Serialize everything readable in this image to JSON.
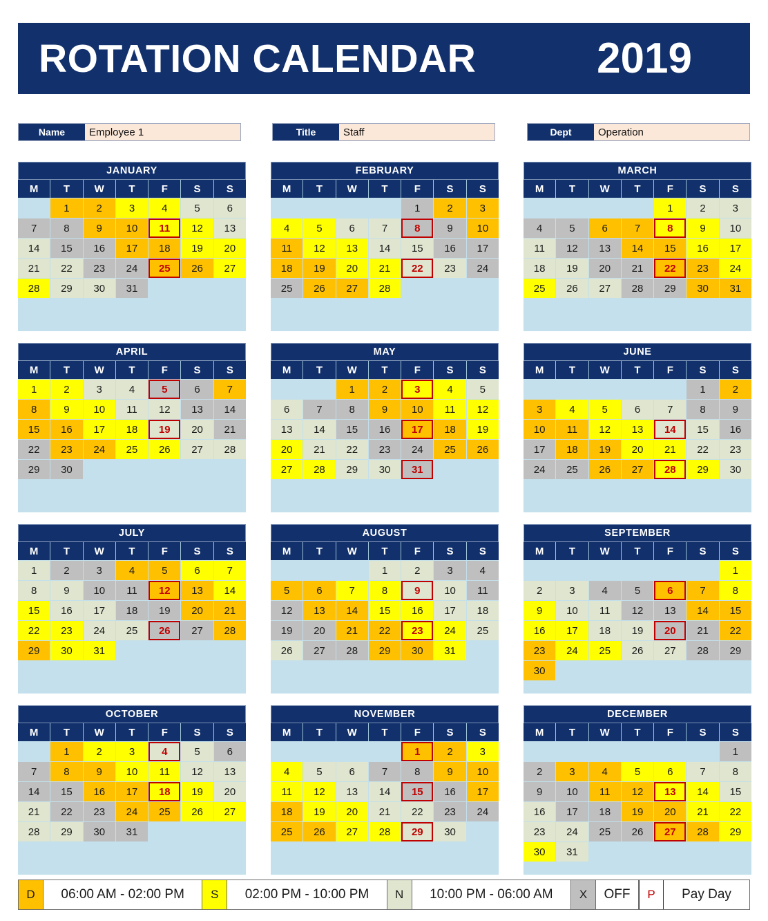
{
  "banner": {
    "title": "ROTATION CALENDAR",
    "year": "2019"
  },
  "info": {
    "name": {
      "label": "Name",
      "value": "Employee 1"
    },
    "title": {
      "label": "Title",
      "value": "Staff"
    },
    "dept": {
      "label": "Dept",
      "value": "Operation"
    }
  },
  "day_headers": [
    "M",
    "T",
    "W",
    "T",
    "F",
    "S",
    "S"
  ],
  "colors": {
    "header_navy": "#12306B",
    "month_bg": "#C3E0EC",
    "shift_D": "#FFC000",
    "shift_S": "#FFFF00",
    "shift_N": "#DFE5CE",
    "shift_X": "#BFBFBF",
    "payday_border": "#C00000",
    "field_value_bg": "#FCE8D9"
  },
  "legend": [
    {
      "code": "D",
      "text": "06:00 AM - 02:00 PM"
    },
    {
      "code": "S",
      "text": "02:00 PM - 10:00 PM"
    },
    {
      "code": "N",
      "text": "10:00 PM - 06:00 AM"
    },
    {
      "code": "X",
      "text": "OFF"
    },
    {
      "code": "P",
      "text": "Pay Day"
    }
  ],
  "months": [
    {
      "name": "JANUARY",
      "lead_blanks": 1,
      "days": 31,
      "shifts": [
        "D",
        "D",
        "S",
        "S",
        "N",
        "N",
        "X",
        "X",
        "D",
        "D",
        "S",
        "S",
        "N",
        "N",
        "X",
        "X",
        "D",
        "D",
        "S",
        "S",
        "N",
        "N",
        "X",
        "X",
        "D",
        "D",
        "S",
        "S",
        "N",
        "N",
        "X"
      ],
      "paydays": [
        11,
        25
      ]
    },
    {
      "name": "FEBRUARY",
      "lead_blanks": 4,
      "days": 28,
      "shifts": [
        "X",
        "D",
        "D",
        "S",
        "S",
        "N",
        "N",
        "X",
        "X",
        "D",
        "D",
        "S",
        "S",
        "N",
        "N",
        "X",
        "X",
        "D",
        "D",
        "S",
        "S",
        "N",
        "N",
        "X",
        "X",
        "D",
        "D",
        "S"
      ],
      "paydays": [
        8,
        22
      ]
    },
    {
      "name": "MARCH",
      "lead_blanks": 4,
      "days": 31,
      "shifts": [
        "S",
        "N",
        "N",
        "X",
        "X",
        "D",
        "D",
        "S",
        "S",
        "N",
        "N",
        "X",
        "X",
        "D",
        "D",
        "S",
        "S",
        "N",
        "N",
        "X",
        "X",
        "D",
        "D",
        "S",
        "S",
        "N",
        "N",
        "X",
        "X",
        "D",
        "D"
      ],
      "paydays": [
        8,
        22
      ]
    },
    {
      "name": "APRIL",
      "lead_blanks": 0,
      "days": 30,
      "shifts": [
        "S",
        "S",
        "N",
        "N",
        "X",
        "X",
        "D",
        "D",
        "S",
        "S",
        "N",
        "N",
        "X",
        "X",
        "D",
        "D",
        "S",
        "S",
        "N",
        "N",
        "X",
        "X",
        "D",
        "D",
        "S",
        "S",
        "N",
        "N",
        "X",
        "X"
      ],
      "paydays": [
        5,
        19
      ]
    },
    {
      "name": "MAY",
      "lead_blanks": 2,
      "days": 31,
      "shifts": [
        "D",
        "D",
        "S",
        "S",
        "N",
        "N",
        "X",
        "X",
        "D",
        "D",
        "S",
        "S",
        "N",
        "N",
        "X",
        "X",
        "D",
        "D",
        "S",
        "S",
        "N",
        "N",
        "X",
        "X",
        "D",
        "D",
        "S",
        "S",
        "N",
        "N",
        "X"
      ],
      "paydays": [
        3,
        17,
        31
      ]
    },
    {
      "name": "JUNE",
      "lead_blanks": 5,
      "days": 30,
      "shifts": [
        "X",
        "D",
        "D",
        "S",
        "S",
        "N",
        "N",
        "X",
        "X",
        "D",
        "D",
        "S",
        "S",
        "N",
        "N",
        "X",
        "X",
        "D",
        "D",
        "S",
        "S",
        "N",
        "N",
        "X",
        "X",
        "D",
        "D",
        "S",
        "S",
        "N"
      ],
      "paydays": [
        14,
        28
      ]
    },
    {
      "name": "JULY",
      "lead_blanks": 0,
      "days": 31,
      "shifts": [
        "N",
        "X",
        "X",
        "D",
        "D",
        "S",
        "S",
        "N",
        "N",
        "X",
        "X",
        "D",
        "D",
        "S",
        "S",
        "N",
        "N",
        "X",
        "X",
        "D",
        "D",
        "S",
        "S",
        "N",
        "N",
        "X",
        "X",
        "D",
        "D",
        "S",
        "S"
      ],
      "paydays": [
        12,
        26
      ]
    },
    {
      "name": "AUGUST",
      "lead_blanks": 3,
      "days": 31,
      "shifts": [
        "N",
        "N",
        "X",
        "X",
        "D",
        "D",
        "S",
        "S",
        "N",
        "N",
        "X",
        "X",
        "D",
        "D",
        "S",
        "S",
        "N",
        "N",
        "X",
        "X",
        "D",
        "D",
        "S",
        "S",
        "N",
        "N",
        "X",
        "X",
        "D",
        "D",
        "S"
      ],
      "paydays": [
        9,
        23
      ]
    },
    {
      "name": "SEPTEMBER",
      "lead_blanks": 6,
      "days": 30,
      "shifts": [
        "S",
        "N",
        "N",
        "X",
        "X",
        "D",
        "D",
        "S",
        "S",
        "N",
        "N",
        "X",
        "X",
        "D",
        "D",
        "S",
        "S",
        "N",
        "N",
        "X",
        "X",
        "D",
        "D",
        "S",
        "S",
        "N",
        "N",
        "X",
        "X",
        "D"
      ],
      "paydays": [
        6,
        20
      ]
    },
    {
      "name": "OCTOBER",
      "lead_blanks": 1,
      "days": 31,
      "shifts": [
        "D",
        "S",
        "S",
        "N",
        "N",
        "X",
        "X",
        "D",
        "D",
        "S",
        "S",
        "N",
        "N",
        "X",
        "X",
        "D",
        "D",
        "S",
        "S",
        "N",
        "N",
        "X",
        "X",
        "D",
        "D",
        "S",
        "S",
        "N",
        "N",
        "X",
        "X"
      ],
      "paydays": [
        4,
        18
      ]
    },
    {
      "name": "NOVEMBER",
      "lead_blanks": 4,
      "days": 30,
      "shifts": [
        "D",
        "D",
        "S",
        "S",
        "N",
        "N",
        "X",
        "X",
        "D",
        "D",
        "S",
        "S",
        "N",
        "N",
        "X",
        "X",
        "D",
        "D",
        "S",
        "S",
        "N",
        "N",
        "X",
        "X",
        "D",
        "D",
        "S",
        "S",
        "N",
        "N"
      ],
      "paydays": [
        1,
        15,
        29
      ]
    },
    {
      "name": "DECEMBER",
      "lead_blanks": 6,
      "days": 31,
      "shifts": [
        "X",
        "X",
        "D",
        "D",
        "S",
        "S",
        "N",
        "N",
        "X",
        "X",
        "D",
        "D",
        "S",
        "S",
        "N",
        "N",
        "X",
        "X",
        "D",
        "D",
        "S",
        "S",
        "N",
        "N",
        "X",
        "X",
        "D",
        "D",
        "S",
        "S",
        "N"
      ],
      "paydays": [
        13,
        27
      ]
    }
  ]
}
